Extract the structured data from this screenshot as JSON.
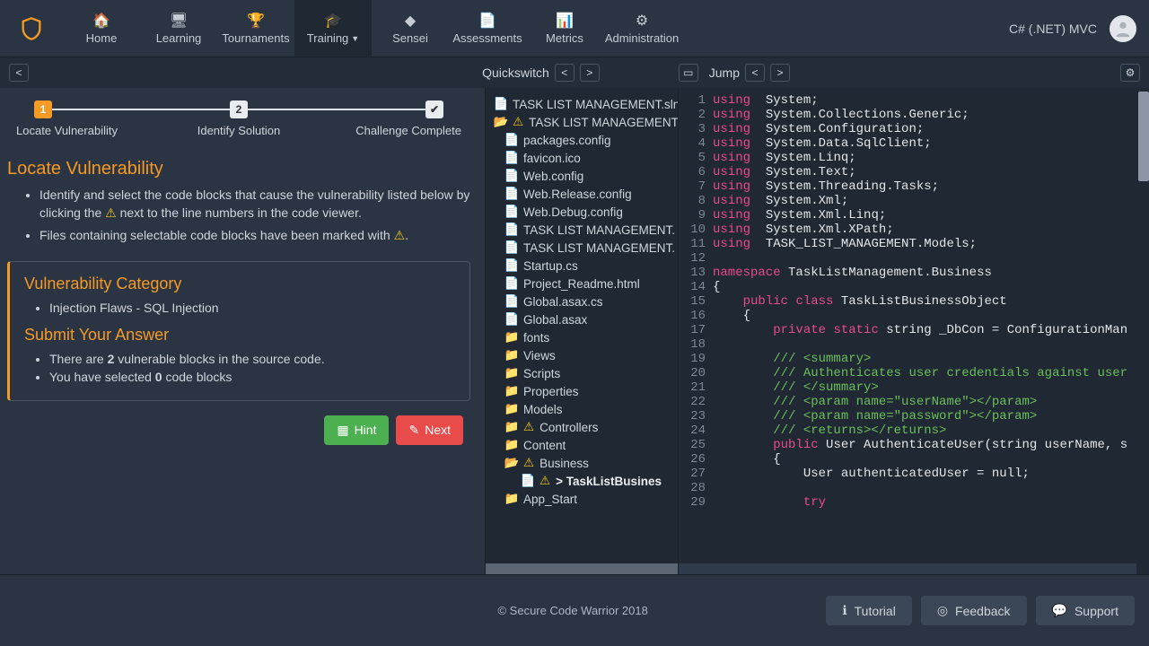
{
  "header": {
    "nav": [
      {
        "label": "Home",
        "icon": "home"
      },
      {
        "label": "Learning",
        "icon": "learning"
      },
      {
        "label": "Tournaments",
        "icon": "trophy"
      },
      {
        "label": "Training",
        "icon": "grad",
        "dropdown": true,
        "active": true
      },
      {
        "label": "Sensei",
        "icon": "sensei"
      },
      {
        "label": "Assessments",
        "icon": "doc"
      },
      {
        "label": "Metrics",
        "icon": "chart"
      },
      {
        "label": "Administration",
        "icon": "gear"
      }
    ],
    "language": "C# (.NET) MVC"
  },
  "subbar": {
    "quickswitch": "Quickswitch",
    "jump": "Jump"
  },
  "steps": {
    "s1": {
      "num": "1",
      "label": "Locate Vulnerability"
    },
    "s2": {
      "num": "2",
      "label": "Identify Solution"
    },
    "s3": {
      "label": "Challenge Complete"
    }
  },
  "instructions": {
    "title": "Locate Vulnerability",
    "b1a": "Identify and select the code blocks that cause the vulnerability listed below by clicking the ",
    "b1b": " next to the line numbers in the code viewer.",
    "b2a": "Files containing selectable code blocks have been marked with ",
    "b2b": "."
  },
  "card": {
    "cat_title": "Vulnerability Category",
    "cat_item": "Injection Flaws - SQL Injection",
    "submit_title": "Submit Your Answer",
    "line1a": "There are ",
    "line1_count": "2",
    "line1b": " vulnerable blocks in the source code.",
    "line2a": "You have selected ",
    "line2_count": "0",
    "line2b": " code blocks"
  },
  "actions": {
    "hint": "Hint",
    "next": "Next"
  },
  "tree": [
    {
      "d": 0,
      "t": "file",
      "warn": false,
      "label": "TASK LIST MANAGEMENT.sln"
    },
    {
      "d": 0,
      "t": "folder-open",
      "warn": true,
      "label": "TASK LIST MANAGEMENT"
    },
    {
      "d": 1,
      "t": "file",
      "warn": false,
      "label": "packages.config"
    },
    {
      "d": 1,
      "t": "file",
      "warn": false,
      "label": "favicon.ico"
    },
    {
      "d": 1,
      "t": "file",
      "warn": false,
      "label": "Web.config"
    },
    {
      "d": 1,
      "t": "file",
      "warn": false,
      "label": "Web.Release.config"
    },
    {
      "d": 1,
      "t": "file",
      "warn": false,
      "label": "Web.Debug.config"
    },
    {
      "d": 1,
      "t": "file",
      "warn": false,
      "label": "TASK LIST MANAGEMENT."
    },
    {
      "d": 1,
      "t": "file",
      "warn": false,
      "label": "TASK LIST MANAGEMENT."
    },
    {
      "d": 1,
      "t": "file",
      "warn": false,
      "label": "Startup.cs"
    },
    {
      "d": 1,
      "t": "file",
      "warn": false,
      "label": "Project_Readme.html"
    },
    {
      "d": 1,
      "t": "file",
      "warn": false,
      "label": "Global.asax.cs"
    },
    {
      "d": 1,
      "t": "file",
      "warn": false,
      "label": "Global.asax"
    },
    {
      "d": 1,
      "t": "folder",
      "warn": false,
      "label": "fonts"
    },
    {
      "d": 1,
      "t": "folder",
      "warn": false,
      "label": "Views"
    },
    {
      "d": 1,
      "t": "folder",
      "warn": false,
      "label": "Scripts"
    },
    {
      "d": 1,
      "t": "folder",
      "warn": false,
      "label": "Properties"
    },
    {
      "d": 1,
      "t": "folder",
      "warn": false,
      "label": "Models"
    },
    {
      "d": 1,
      "t": "folder",
      "warn": true,
      "label": "Controllers"
    },
    {
      "d": 1,
      "t": "folder",
      "warn": false,
      "label": "Content"
    },
    {
      "d": 1,
      "t": "folder-open",
      "warn": true,
      "label": "Business"
    },
    {
      "d": 2,
      "t": "file",
      "warn": true,
      "label": "> TaskListBusines",
      "bold": true
    },
    {
      "d": 1,
      "t": "folder",
      "warn": false,
      "label": "App_Start"
    }
  ],
  "code": [
    {
      "n": 1,
      "h": "<span class='tok-kw'>using</span>  <span class='tok-type'>System;</span>"
    },
    {
      "n": 2,
      "h": "<span class='tok-kw'>using</span>  <span class='tok-type'>System.Collections.Generic;</span>"
    },
    {
      "n": 3,
      "h": "<span class='tok-kw'>using</span>  <span class='tok-type'>System.Configuration;</span>"
    },
    {
      "n": 4,
      "h": "<span class='tok-kw'>using</span>  <span class='tok-type'>System.Data.SqlClient;</span>"
    },
    {
      "n": 5,
      "h": "<span class='tok-kw'>using</span>  <span class='tok-type'>System.Linq;</span>"
    },
    {
      "n": 6,
      "h": "<span class='tok-kw'>using</span>  <span class='tok-type'>System.Text;</span>"
    },
    {
      "n": 7,
      "h": "<span class='tok-kw'>using</span>  <span class='tok-type'>System.Threading.Tasks;</span>"
    },
    {
      "n": 8,
      "h": "<span class='tok-kw'>using</span>  <span class='tok-type'>System.Xml;</span>"
    },
    {
      "n": 9,
      "h": "<span class='tok-kw'>using</span>  <span class='tok-type'>System.Xml.Linq;</span>"
    },
    {
      "n": 10,
      "h": "<span class='tok-kw'>using</span>  <span class='tok-type'>System.Xml.XPath;</span>"
    },
    {
      "n": 11,
      "h": "<span class='tok-kw'>using</span>  <span class='tok-type'>TASK_LIST_MANAGEMENT.Models;</span>"
    },
    {
      "n": 12,
      "h": ""
    },
    {
      "n": 13,
      "h": "<span class='tok-kw'>namespace</span> <span class='tok-type'>TaskListManagement.Business</span>"
    },
    {
      "n": 14,
      "h": "<span class='tok-type'>{</span>"
    },
    {
      "n": 15,
      "h": "    <span class='tok-pub'>public</span> <span class='tok-class'>class</span> <span class='tok-type'>TaskListBusinessObject</span>"
    },
    {
      "n": 16,
      "h": "    <span class='tok-type'>{</span>"
    },
    {
      "n": 17,
      "h": "        <span class='tok-pub'>private</span> <span class='tok-pub'>static</span> <span class='tok-type'>string _DbCon = ConfigurationMan</span>"
    },
    {
      "n": 18,
      "h": ""
    },
    {
      "n": 19,
      "h": "        <span class='tok-comment'>/// &lt;summary&gt;</span>"
    },
    {
      "n": 20,
      "h": "        <span class='tok-comment'>/// Authenticates user credentials against user</span>"
    },
    {
      "n": 21,
      "h": "        <span class='tok-comment'>/// &lt;/summary&gt;</span>"
    },
    {
      "n": 22,
      "h": "        <span class='tok-comment'>/// &lt;param name=&quot;userName&quot;&gt;&lt;/param&gt;</span>"
    },
    {
      "n": 23,
      "h": "        <span class='tok-comment'>/// &lt;param name=&quot;password&quot;&gt;&lt;/param&gt;</span>"
    },
    {
      "n": 24,
      "h": "        <span class='tok-comment'>/// &lt;returns&gt;&lt;/returns&gt;</span>"
    },
    {
      "n": 25,
      "h": "        <span class='tok-pub'>public</span> <span class='tok-type'>User AuthenticateUser(string userName, s</span>"
    },
    {
      "n": 26,
      "h": "        <span class='tok-type'>{</span>"
    },
    {
      "n": 27,
      "h": "            <span class='tok-type'>User authenticatedUser = null;</span>"
    },
    {
      "n": 28,
      "h": ""
    },
    {
      "n": 29,
      "h": "            <span class='tok-kw'>try</span>"
    }
  ],
  "footer": {
    "copyright": "© Secure Code Warrior 2018",
    "tutorial": "Tutorial",
    "feedback": "Feedback",
    "support": "Support"
  }
}
